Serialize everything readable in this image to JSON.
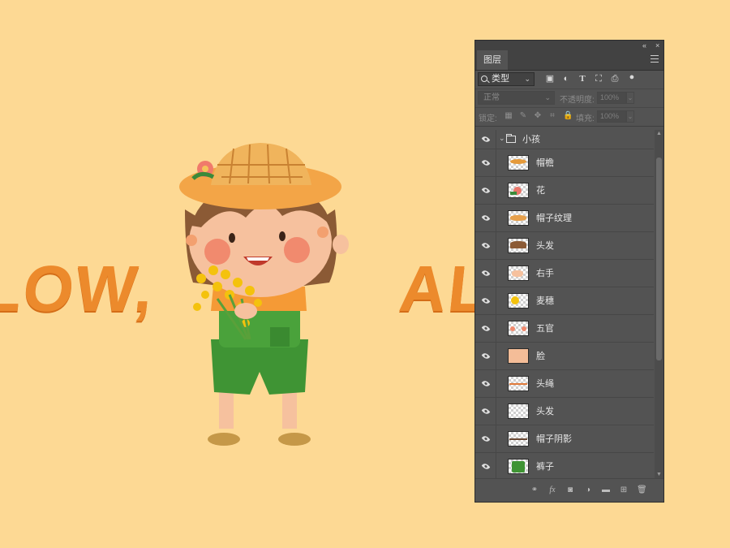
{
  "canvas": {
    "background": "#fdd994",
    "text_left": "LOW,",
    "text_right": "AL      N."
  },
  "panel": {
    "collapse_glyph": "«",
    "close_glyph": "×",
    "tab_label": "图层",
    "filter": {
      "kind_label": "类型"
    },
    "blend": {
      "mode": "正常",
      "opacity_label": "不透明度:",
      "opacity_value": "100%"
    },
    "lock": {
      "label": "锁定:",
      "fill_label": "填充:",
      "fill_value": "100%"
    },
    "layers": [
      {
        "name": "小孩",
        "type": "group"
      },
      {
        "name": "帽檐",
        "type": "layer",
        "thumb": "hat-brim"
      },
      {
        "name": "花",
        "type": "layer",
        "thumb": "flower"
      },
      {
        "name": "帽子纹理",
        "type": "layer",
        "thumb": "hat-texture"
      },
      {
        "name": "头发",
        "type": "layer",
        "thumb": "hair"
      },
      {
        "name": "右手",
        "type": "layer",
        "thumb": "right-hand"
      },
      {
        "name": "麦穗",
        "type": "layer",
        "thumb": "wheat"
      },
      {
        "name": "五官",
        "type": "layer",
        "thumb": "features"
      },
      {
        "name": "脸",
        "type": "layer",
        "thumb": "face"
      },
      {
        "name": "头绳",
        "type": "layer",
        "thumb": "hair-tie"
      },
      {
        "name": "头发",
        "type": "layer",
        "thumb": "hair-back"
      },
      {
        "name": "帽子阴影",
        "type": "layer",
        "thumb": "hat-shadow"
      },
      {
        "name": "裤子",
        "type": "layer",
        "thumb": "pants"
      }
    ],
    "footer_icons": [
      "link-icon",
      "fx-icon",
      "mask-icon",
      "adjustment-icon",
      "new-group-icon",
      "new-layer-icon",
      "trash-icon"
    ]
  }
}
